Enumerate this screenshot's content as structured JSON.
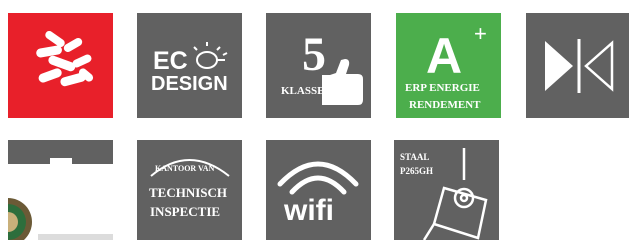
{
  "tiles": {
    "ecodesign": {
      "line1": "EC",
      "line2": "DESIGN"
    },
    "klasse": {
      "number": "5",
      "label": "KLASSE"
    },
    "energy": {
      "grade": "A",
      "plus": "+",
      "line1": "ERP ENERGIE",
      "line2": "RENDEMENT"
    },
    "kantoor": {
      "line1": "KANTOOR VAN",
      "line2": "TECHNISCH",
      "line3": "INSPECTIE"
    },
    "wifi": {
      "label": "wifi"
    },
    "staal": {
      "line1": "STAAL",
      "line2": "P265GH"
    }
  },
  "colors": {
    "gray": "#616161",
    "red": "#e8202a",
    "green": "#4cae4c",
    "white": "#ffffff"
  }
}
